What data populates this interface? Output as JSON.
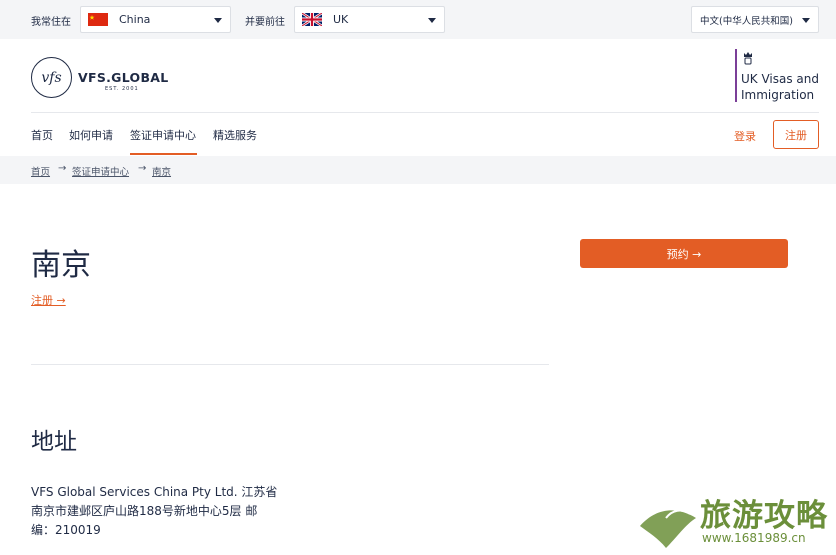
{
  "topbar": {
    "residence_label": "我常住在",
    "residence_value": "China",
    "destination_label": "并要前往",
    "destination_value": "UK",
    "language_value": "中文(中华人民共和国)"
  },
  "brand": {
    "logo_mark": "vfs",
    "logo_text": "VFS.GLOBAL",
    "logo_est": "EST. 2001",
    "partner_line1": "UK Visas and",
    "partner_line2": "Immigration"
  },
  "nav": {
    "items": [
      {
        "label": "首页"
      },
      {
        "label": "如何申请"
      },
      {
        "label": "签证申请中心"
      },
      {
        "label": "精选服务"
      }
    ],
    "active_index": 2,
    "login_label": "登录",
    "register_label": "注册"
  },
  "breadcrumb": [
    "首页",
    "签证申请中心",
    "南京"
  ],
  "page": {
    "title": "南京",
    "register_link": "注册 →",
    "book_button": "预约 →"
  },
  "address": {
    "heading": "地址",
    "lines": [
      "VFS Global Services China Pty Ltd. 江苏省",
      "南京市建邺区庐山路188号新地中心5层 邮",
      "编：210019"
    ]
  },
  "watermark": {
    "text": "旅游攻略",
    "url": "www.1681989.cn"
  },
  "colors": {
    "accent": "#e35d25",
    "text": "#1f2a44",
    "ukvi_bar": "#7b3f98",
    "watermark": "#6b8f3a"
  }
}
